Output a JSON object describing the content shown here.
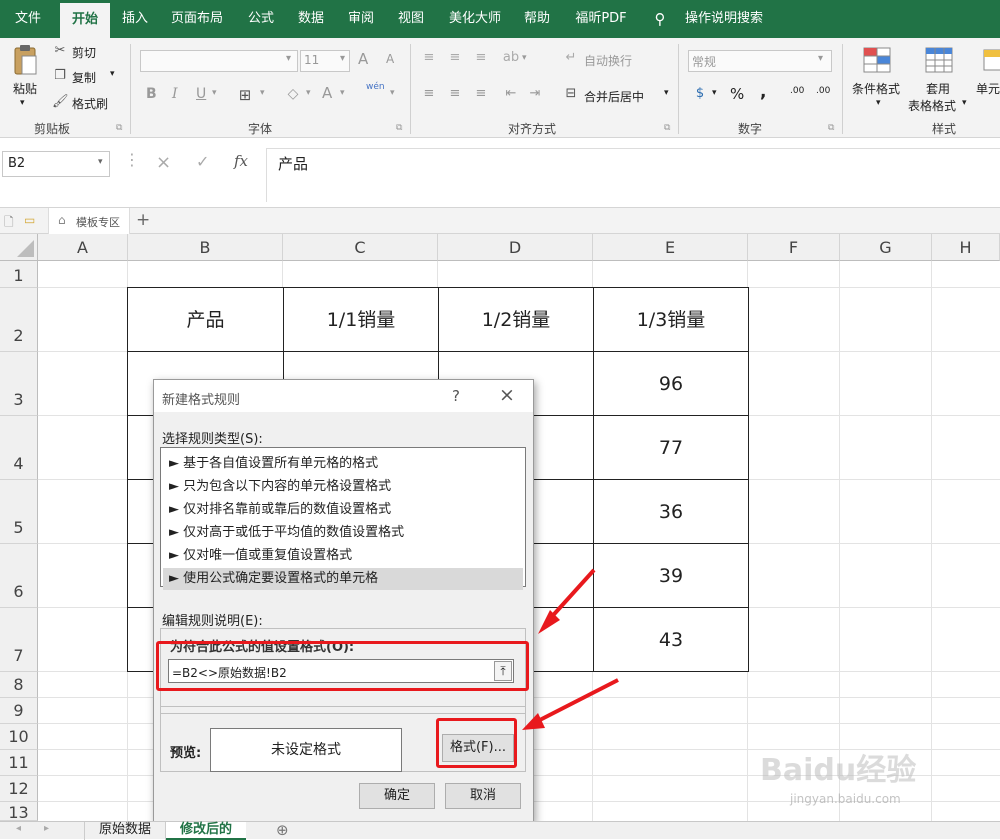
{
  "ribbon_tabs": [
    "文件",
    "开始",
    "插入",
    "页面布局",
    "公式",
    "数据",
    "审阅",
    "视图",
    "美化大师",
    "帮助",
    "福昕PDF",
    "操作说明搜索"
  ],
  "clipboard": {
    "paste": "粘贴",
    "cut": "剪切",
    "copy": "复制",
    "format_painter": "格式刷",
    "label": "剪贴板"
  },
  "font": {
    "size": "11",
    "bold": "B",
    "italic": "I",
    "underline": "U",
    "label": "字体",
    "a_plus": "A",
    "a_minus": "A",
    "wen": "wén",
    "font_color": "A"
  },
  "alignment": {
    "wrap": "自动换行",
    "merge": "合并后居中",
    "label": "对齐方式"
  },
  "number": {
    "format": "常规",
    "percent": "%",
    "comma": ",",
    "dec_inc": ".00",
    "dec_dec": ".00",
    "label": "数字"
  },
  "styles": {
    "conditional": "条件格式",
    "table_format_1": "套用",
    "table_format_2": "表格格式",
    "cell_styles": "单元",
    "label": "样式"
  },
  "formula_bar": {
    "name_box": "B2",
    "cancel": "×",
    "enter": "✓",
    "fx": "fx",
    "value": "产品"
  },
  "workbook_tabs": {
    "template_zone": "模板专区",
    "add": "+"
  },
  "columns": [
    "A",
    "B",
    "C",
    "D",
    "E",
    "F",
    "G",
    "H"
  ],
  "rows": [
    "1",
    "2",
    "3",
    "4",
    "5",
    "6",
    "7",
    "8",
    "9",
    "10",
    "11",
    "12",
    "13"
  ],
  "table": {
    "headers": [
      "产品",
      "1/1销量",
      "1/2销量",
      "1/3销量"
    ],
    "visible": [
      {
        "c": "",
        "d": "",
        "e": "96"
      },
      {
        "c": "",
        "d": "",
        "e": "77"
      },
      {
        "c": "",
        "d": "",
        "e": "36"
      },
      {
        "c": "",
        "d": "",
        "e": "39"
      },
      {
        "c": "",
        "d": "",
        "e": "43"
      }
    ]
  },
  "dialog": {
    "title": "新建格式规则",
    "help": "?",
    "close": "×",
    "select_type": "选择规则类型(S):",
    "rule_types": [
      "► 基于各自值设置所有单元格的格式",
      "► 只为包含以下内容的单元格设置格式",
      "► 仅对排名靠前或靠后的数值设置格式",
      "► 仅对高于或低于平均值的数值设置格式",
      "► 仅对唯一值或重复值设置格式",
      "► 使用公式确定要设置格式的单元格"
    ],
    "edit_desc": "编辑规则说明(E):",
    "formula_label": "为符合此公式的值设置格式(O):",
    "formula": "=B2<>原始数据!B2",
    "preview_label": "预览:",
    "preview_text": "未设定格式",
    "format_button": "格式(F)...",
    "ok": "确定",
    "cancel": "取消"
  },
  "sheet_tabs": [
    "原始数据",
    "修改后的"
  ],
  "watermark": {
    "brand": "Baidu经验",
    "url": "jingyan.baidu.com"
  },
  "colors": {
    "excel_green": "#217346",
    "annotation_red": "#e8191d"
  }
}
